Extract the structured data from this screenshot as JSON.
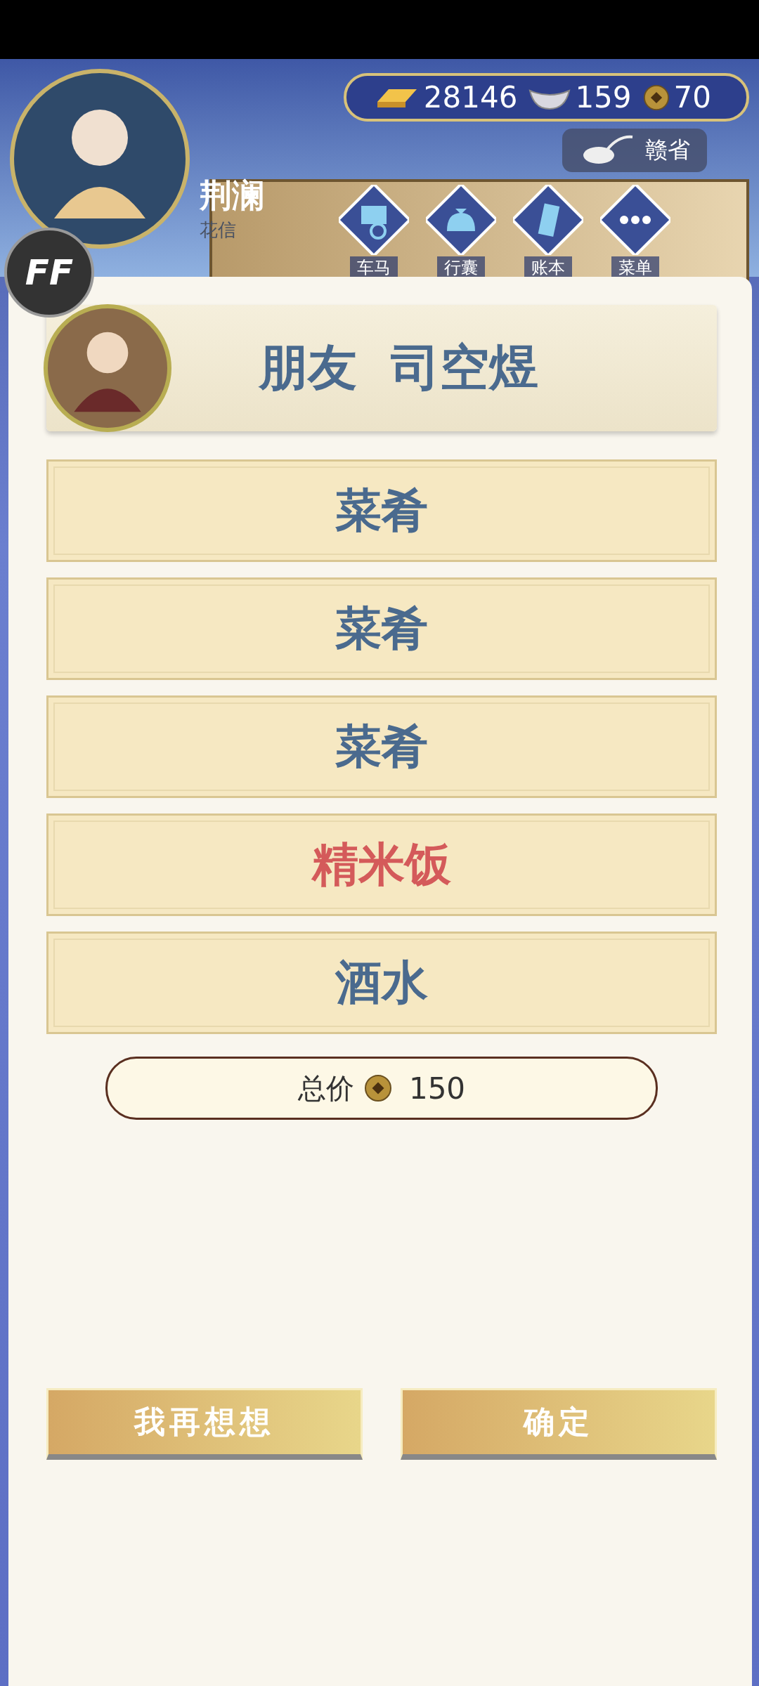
{
  "player": {
    "name": "荆澜",
    "subtitle": "花信"
  },
  "currency": [
    {
      "kind": "gold",
      "amount": "28146"
    },
    {
      "kind": "silver",
      "amount": "159"
    },
    {
      "kind": "coin",
      "amount": "70"
    }
  ],
  "location": "赣省",
  "nav": [
    {
      "kind": "carriage",
      "label": "车马"
    },
    {
      "kind": "bag",
      "label": "行囊"
    },
    {
      "kind": "book",
      "label": "账本"
    },
    {
      "kind": "menu",
      "label": "菜单"
    }
  ],
  "badge": "FF",
  "dialog": {
    "title": "朋友  司空煜",
    "options": [
      {
        "label": "菜肴",
        "highlighted": false
      },
      {
        "label": "菜肴",
        "highlighted": false
      },
      {
        "label": "菜肴",
        "highlighted": false
      },
      {
        "label": "精米饭",
        "highlighted": true
      },
      {
        "label": "酒水",
        "highlighted": false
      }
    ],
    "total_label": "总价",
    "total": "150",
    "buttons": [
      "我再想想",
      "确定"
    ]
  }
}
